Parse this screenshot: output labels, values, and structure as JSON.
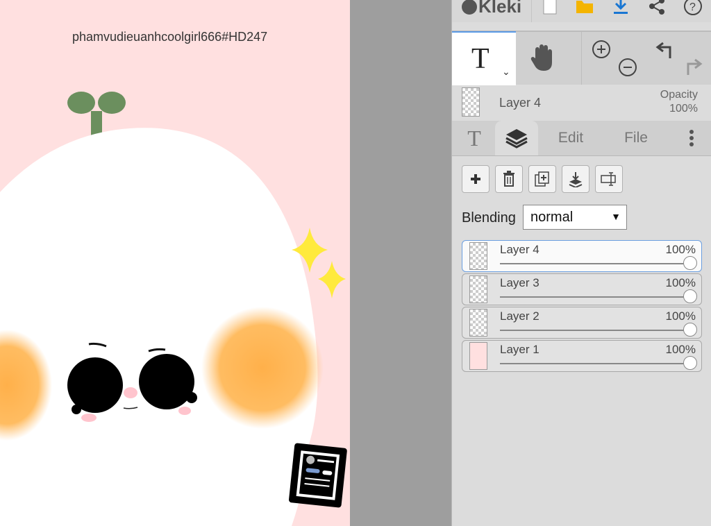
{
  "canvas": {
    "text": "phamvudieuanhcoolgirl666#HD247"
  },
  "app": {
    "name": "Kleki"
  },
  "toolbar": {
    "text_tool_letter": "T",
    "text_tool_chevron": "⌄"
  },
  "layer_info": {
    "name": "Layer 4",
    "opacity_label": "Opacity",
    "opacity_value": "100%"
  },
  "tabs": [
    {
      "label": "T",
      "icon": "text-icon"
    },
    {
      "label": "",
      "icon": "layers-icon"
    },
    {
      "label": "Edit"
    },
    {
      "label": "File"
    },
    {
      "label": "",
      "icon": "more-vertical-icon"
    }
  ],
  "layer_actions": [
    "add-layer-icon",
    "delete-layer-icon",
    "duplicate-layer-icon",
    "merge-down-icon",
    "rename-layer-icon"
  ],
  "blending": {
    "label": "Blending",
    "value": "normal"
  },
  "layers": [
    {
      "name": "Layer 4",
      "opacity": "100%",
      "opacity_fraction": 1.0,
      "active": true
    },
    {
      "name": "Layer 3",
      "opacity": "100%",
      "opacity_fraction": 1.0,
      "active": false
    },
    {
      "name": "Layer 2",
      "opacity": "100%",
      "opacity_fraction": 1.0,
      "active": false
    },
    {
      "name": "Layer 1",
      "opacity": "100%",
      "opacity_fraction": 1.0,
      "active": false
    }
  ],
  "colors": {
    "canvas_bg": "#ffe0e0",
    "accent_blue": "#5a9ae6",
    "download_blue": "#1976d2",
    "open_yellow": "#f4b400"
  }
}
